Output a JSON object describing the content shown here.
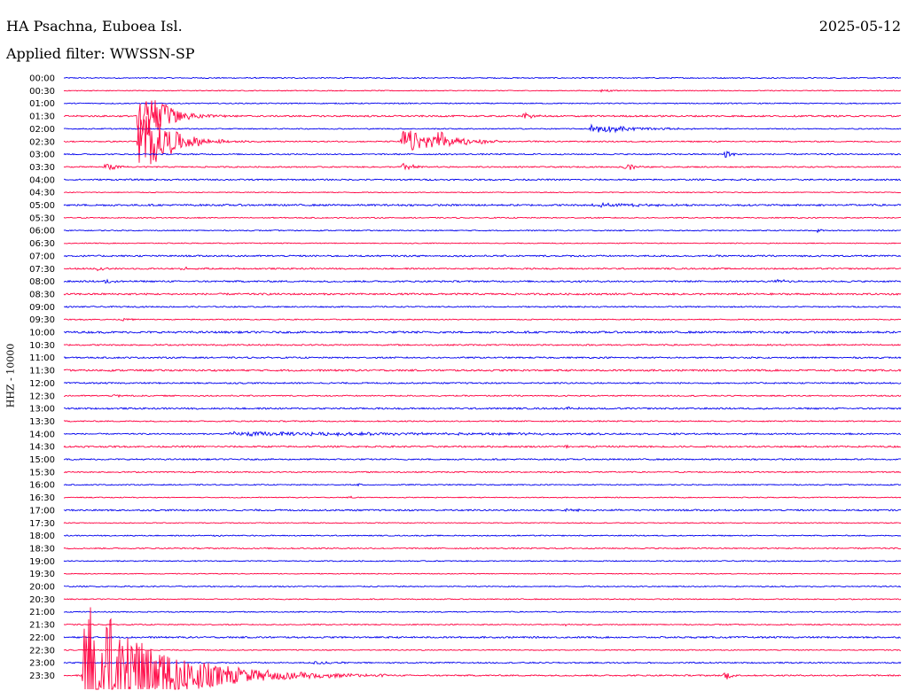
{
  "header": {
    "station": "HA Psachna, Euboea Isl.",
    "filter": "Applied filter: WWSSN-SP",
    "date": "2025-05-12"
  },
  "colors": {
    "odd": "#0000ee",
    "even": "#ff0040"
  },
  "chart_data": {
    "type": "line",
    "title": "HA Psachna, Euboea Isl.",
    "subtitle": "Applied filter: WWSSN-SP",
    "ylabel": "HHZ - 10000",
    "xlabel": "",
    "grid": false,
    "legend": "none",
    "rows": [
      "00:00",
      "00:30",
      "01:00",
      "01:30",
      "02:00",
      "02:30",
      "03:00",
      "03:30",
      "04:00",
      "04:30",
      "05:00",
      "05:30",
      "06:00",
      "06:30",
      "07:00",
      "07:30",
      "08:00",
      "08:30",
      "09:00",
      "09:30",
      "10:00",
      "10:30",
      "11:00",
      "11:30",
      "12:00",
      "12:30",
      "13:00",
      "13:30",
      "14:00",
      "14:30",
      "15:00",
      "15:30",
      "16:00",
      "16:30",
      "17:00",
      "17:30",
      "18:00",
      "18:30",
      "19:00",
      "19:30",
      "20:00",
      "20:30",
      "21:00",
      "21:30",
      "22:00",
      "22:30",
      "23:00",
      "23:30"
    ],
    "traces": [
      {
        "row": "00:00",
        "noise": 0.6,
        "events": []
      },
      {
        "row": "00:30",
        "noise": 0.5,
        "events": [
          {
            "t": 0.64,
            "amp": 1.5,
            "dur": 0.02
          }
        ]
      },
      {
        "row": "01:00",
        "noise": 0.6,
        "events": []
      },
      {
        "row": "01:30",
        "noise": 0.9,
        "events": [
          {
            "t": 0.09,
            "amp": -42,
            "dur": 0.04
          },
          {
            "t": 0.55,
            "amp": 4,
            "dur": 0.015
          }
        ]
      },
      {
        "row": "02:00",
        "noise": 0.6,
        "events": [
          {
            "t": 0.63,
            "amp": 5,
            "dur": 0.08
          }
        ]
      },
      {
        "row": "02:30",
        "noise": 0.7,
        "events": [
          {
            "t": 0.09,
            "amp": 45,
            "dur": 0.05
          },
          {
            "t": 0.19,
            "amp": 2,
            "dur": 0.01
          },
          {
            "t": 0.405,
            "amp": 16,
            "dur": 0.05
          },
          {
            "t": 0.44,
            "amp": 11,
            "dur": 0.05
          }
        ]
      },
      {
        "row": "03:00",
        "noise": 0.7,
        "events": [
          {
            "t": 0.79,
            "amp": 5,
            "dur": 0.012
          }
        ]
      },
      {
        "row": "03:30",
        "noise": 0.7,
        "events": [
          {
            "t": 0.05,
            "amp": 6,
            "dur": 0.015
          },
          {
            "t": 0.405,
            "amp": 4,
            "dur": 0.03
          },
          {
            "t": 0.67,
            "amp": 6,
            "dur": 0.015
          }
        ]
      },
      {
        "row": "04:00",
        "noise": 0.8,
        "events": []
      },
      {
        "row": "04:30",
        "noise": 0.5,
        "events": []
      },
      {
        "row": "05:00",
        "noise": 1.0,
        "events": [
          {
            "t": 0.63,
            "amp": 2,
            "dur": 0.1
          }
        ]
      },
      {
        "row": "05:30",
        "noise": 0.6,
        "events": []
      },
      {
        "row": "06:00",
        "noise": 0.6,
        "events": [
          {
            "t": 0.9,
            "amp": 2.5,
            "dur": 0.012
          }
        ]
      },
      {
        "row": "06:30",
        "noise": 0.5,
        "events": []
      },
      {
        "row": "07:00",
        "noise": 0.9,
        "events": []
      },
      {
        "row": "07:30",
        "noise": 0.8,
        "events": [
          {
            "t": 0.04,
            "amp": 2,
            "dur": 0.02
          },
          {
            "t": 0.14,
            "amp": 2,
            "dur": 0.02
          }
        ]
      },
      {
        "row": "08:00",
        "noise": 0.9,
        "events": [
          {
            "t": 0.05,
            "amp": 2.5,
            "dur": 0.01
          },
          {
            "t": 0.85,
            "amp": 2.5,
            "dur": 0.02
          }
        ]
      },
      {
        "row": "08:30",
        "noise": 1.0,
        "events": []
      },
      {
        "row": "09:00",
        "noise": 0.7,
        "events": []
      },
      {
        "row": "09:30",
        "noise": 0.6,
        "events": [
          {
            "t": 0.07,
            "amp": 1.5,
            "dur": 0.02
          }
        ]
      },
      {
        "row": "10:00",
        "noise": 1.1,
        "events": []
      },
      {
        "row": "10:30",
        "noise": 0.8,
        "events": []
      },
      {
        "row": "11:00",
        "noise": 0.8,
        "events": []
      },
      {
        "row": "11:30",
        "noise": 1.0,
        "events": []
      },
      {
        "row": "12:00",
        "noise": 0.8,
        "events": []
      },
      {
        "row": "12:30",
        "noise": 0.7,
        "events": [
          {
            "t": 0.06,
            "amp": 1.5,
            "dur": 0.03
          }
        ]
      },
      {
        "row": "13:00",
        "noise": 0.9,
        "events": [
          {
            "t": 0.6,
            "amp": 2,
            "dur": 0.02
          }
        ]
      },
      {
        "row": "13:30",
        "noise": 0.7,
        "events": []
      },
      {
        "row": "14:00",
        "noise": 0.7,
        "events": [
          {
            "t": 0.2,
            "amp": 2.2,
            "dur": 0.55
          }
        ]
      },
      {
        "row": "14:30",
        "noise": 0.9,
        "events": [
          {
            "t": 0.6,
            "amp": 1.5,
            "dur": 0.05
          }
        ]
      },
      {
        "row": "15:00",
        "noise": 0.8,
        "events": []
      },
      {
        "row": "15:30",
        "noise": 0.7,
        "events": []
      },
      {
        "row": "16:00",
        "noise": 0.6,
        "events": [
          {
            "t": 0.35,
            "amp": 1.5,
            "dur": 0.01
          }
        ]
      },
      {
        "row": "16:30",
        "noise": 0.5,
        "events": [
          {
            "t": 0.34,
            "amp": 1.5,
            "dur": 0.01
          }
        ]
      },
      {
        "row": "17:00",
        "noise": 0.9,
        "events": [
          {
            "t": 0.6,
            "amp": 1.5,
            "dur": 0.03
          }
        ]
      },
      {
        "row": "17:30",
        "noise": 0.5,
        "events": []
      },
      {
        "row": "18:00",
        "noise": 0.6,
        "events": [
          {
            "t": 0.18,
            "amp": 1.5,
            "dur": 0.02
          }
        ]
      },
      {
        "row": "18:30",
        "noise": 0.7,
        "events": []
      },
      {
        "row": "19:00",
        "noise": 0.6,
        "events": []
      },
      {
        "row": "19:30",
        "noise": 0.5,
        "events": []
      },
      {
        "row": "20:00",
        "noise": 0.6,
        "events": []
      },
      {
        "row": "20:30",
        "noise": 0.6,
        "events": []
      },
      {
        "row": "21:00",
        "noise": 0.6,
        "events": []
      },
      {
        "row": "21:30",
        "noise": 0.6,
        "events": [
          {
            "t": 0.6,
            "amp": 1.5,
            "dur": 0.005
          }
        ]
      },
      {
        "row": "22:00",
        "noise": 0.9,
        "events": []
      },
      {
        "row": "22:30",
        "noise": 0.6,
        "events": []
      },
      {
        "row": "23:00",
        "noise": 0.7,
        "events": [
          {
            "t": 0.3,
            "amp": 2,
            "dur": 0.035
          }
        ]
      },
      {
        "row": "23:30",
        "noise": 0.8,
        "events": [
          {
            "t": 0.025,
            "amp": -100,
            "dur": 0.12
          },
          {
            "t": 0.79,
            "amp": 6,
            "dur": 0.01
          }
        ]
      }
    ]
  }
}
